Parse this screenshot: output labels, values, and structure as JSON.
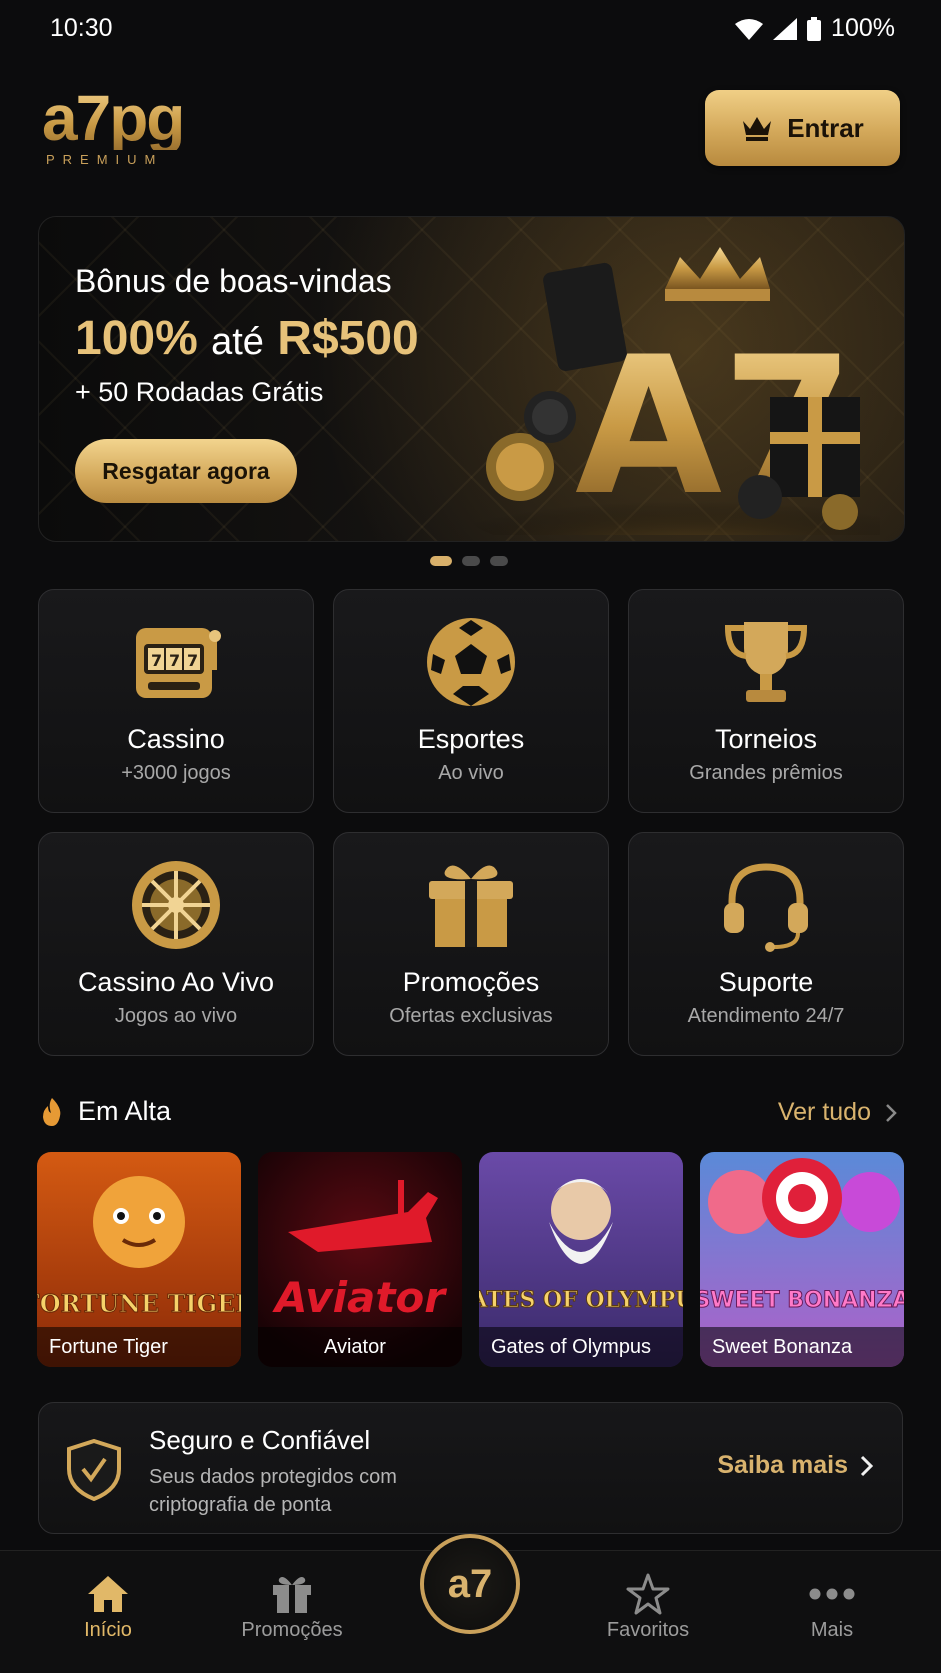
{
  "status": {
    "time": "10:30",
    "battery": "100%"
  },
  "header": {
    "logo_main": "a7pg",
    "logo_sub": "PREMIUM",
    "login_label": "Entrar"
  },
  "banner": {
    "title": "Bônus de boas-vindas",
    "amount_pct": "100%",
    "amount_mid": "até",
    "amount_value": "R$500",
    "spins": "+ 50 Rodadas Grátis",
    "cta": "Resgatar agora",
    "art_text": "A7"
  },
  "categories": [
    {
      "title": "Cassino",
      "subtitle": "+3000 jogos",
      "icon": "slot-machine-icon"
    },
    {
      "title": "Esportes",
      "subtitle": "Ao vivo",
      "icon": "soccer-ball-icon"
    },
    {
      "title": "Torneios",
      "subtitle": "Grandes prêmios",
      "icon": "trophy-icon"
    },
    {
      "title": "Cassino Ao Vivo",
      "subtitle": "Jogos ao vivo",
      "icon": "roulette-icon"
    },
    {
      "title": "Promoções",
      "subtitle": "Ofertas exclusivas",
      "icon": "gift-icon"
    },
    {
      "title": "Suporte",
      "subtitle": "Atendimento 24/7",
      "icon": "headset-icon"
    }
  ],
  "trending": {
    "title": "Em Alta",
    "see_all": "Ver tudo",
    "games": [
      {
        "name": "Fortune Tiger",
        "art": "FORTUNE TIGER"
      },
      {
        "name": "Aviator",
        "art": "Aviator"
      },
      {
        "name": "Gates of Olympus",
        "art": "GATES OF OLYMPUS"
      },
      {
        "name": "Sweet Bonanza",
        "art": "SWEET BONANZA"
      }
    ]
  },
  "trust": {
    "title": "Seguro e Confiável",
    "desc": "Seus dados protegidos com criptografia de ponta",
    "link": "Saiba mais"
  },
  "nav": {
    "items": [
      "Início",
      "Promoções",
      "Favoritos",
      "Mais"
    ],
    "center": "a7"
  },
  "colors": {
    "gold": "#d9b36e",
    "background": "#0c0c0d"
  }
}
